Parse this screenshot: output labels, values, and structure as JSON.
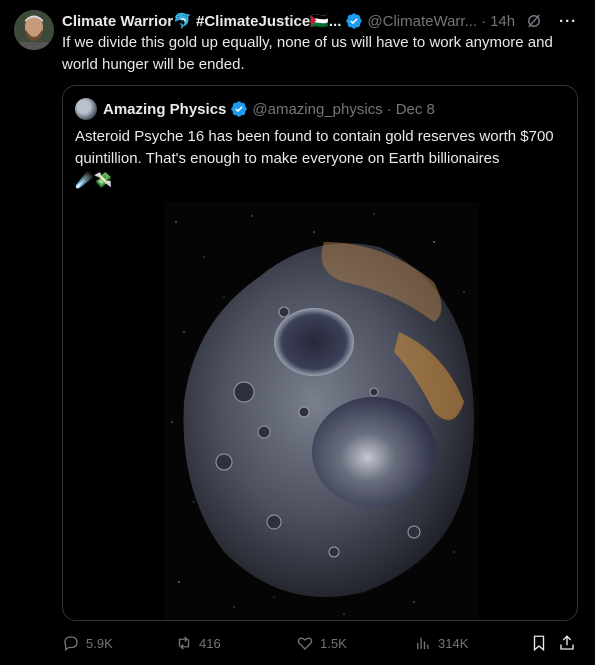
{
  "tweet": {
    "author_name": "Climate Warrior🐬 #ClimateJustice🇵🇸...",
    "handle": "@ClimateWarr...",
    "dot": "·",
    "time": "14h",
    "more": "···",
    "text": "If we divide this gold up equally, none of us will have to work anymore and world hunger will be ended."
  },
  "quote": {
    "author_name": "Amazing Physics",
    "handle": "@amazing_physics",
    "dot": "·",
    "date": "Dec 8",
    "text": "Asteroid Psyche 16 has been found to contain gold reserves worth $700 quintillion. That's enough to make everyone on Earth billionaires",
    "emoji": "☄️💸"
  },
  "actions": {
    "replies": "5.9K",
    "reposts": "416",
    "likes": "1.5K",
    "views": "314K"
  },
  "colors": {
    "background": "#000000",
    "text": "#e7e9ea",
    "muted": "#71767b",
    "verified": "#1d9bf0",
    "border": "#2f3336"
  }
}
